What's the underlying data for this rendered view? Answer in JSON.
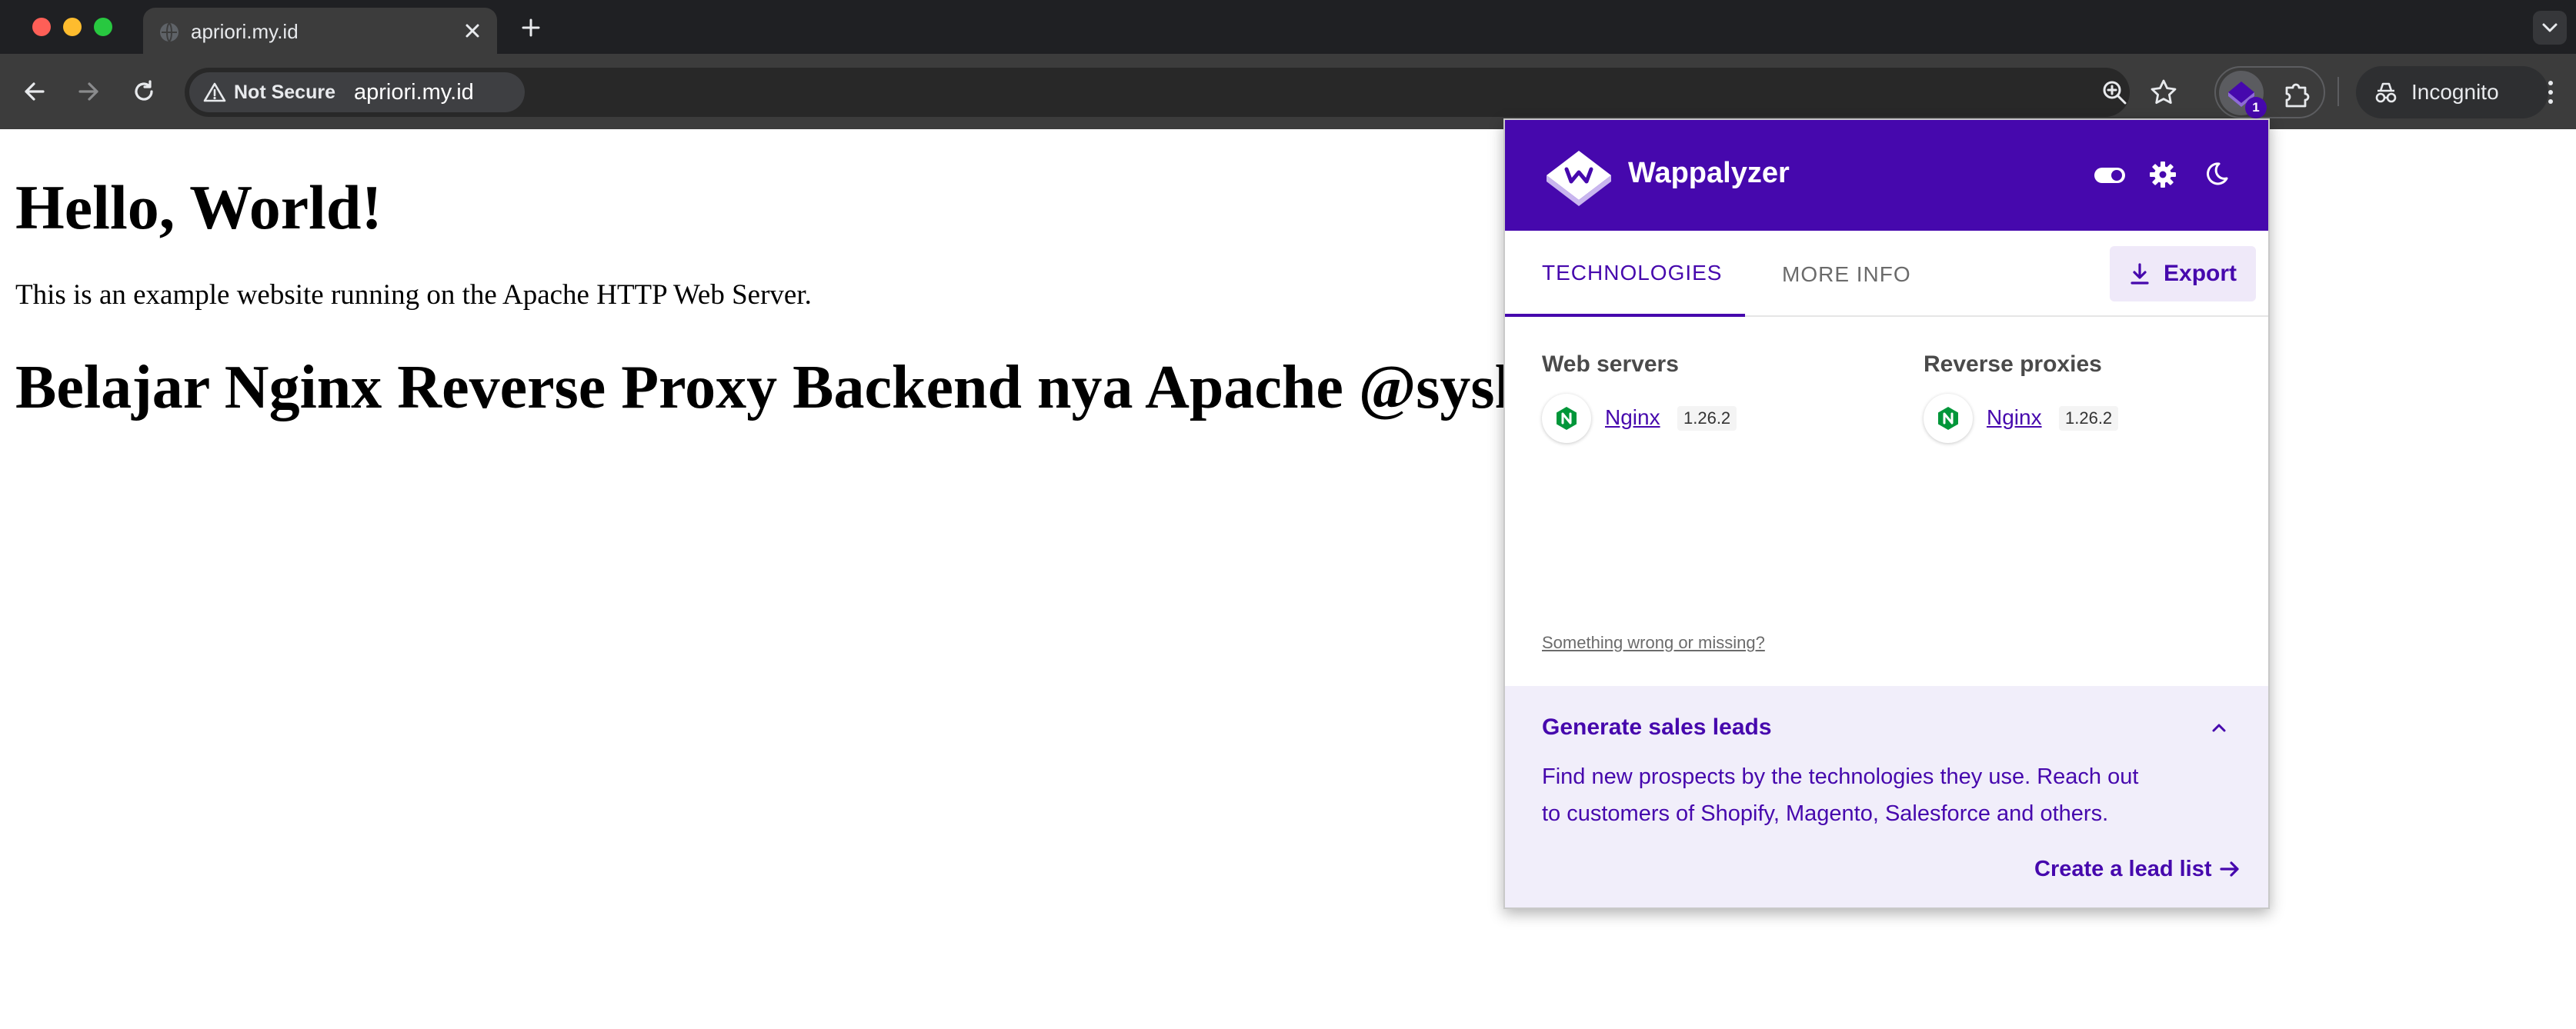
{
  "browser": {
    "tab": {
      "title": "apriori.my.id"
    },
    "address_bar": {
      "security_label": "Not Secure",
      "url": "apriori.my.id"
    },
    "profile_label": "Incognito",
    "extension_badge": "1",
    "icons": [
      "back-icon",
      "forward-icon",
      "reload-icon",
      "warning-icon",
      "zoom-icon",
      "star-icon",
      "puzzle-icon",
      "incognito-icon",
      "kebab-menu-icon"
    ]
  },
  "page": {
    "heading": "Hello, World!",
    "paragraph": "This is an example website running on the Apache HTTP Web Server.",
    "subheading": "Belajar Nginx Reverse Proxy Backend nya Apache @syshabit"
  },
  "wappalyzer": {
    "brand": "Wappalyzer",
    "tabs": {
      "technologies": "TECHNOLOGIES",
      "more_info": "MORE INFO"
    },
    "export_label": "Export",
    "categories": [
      {
        "title": "Web servers",
        "tech": {
          "name": "Nginx",
          "version": "1.26.2"
        }
      },
      {
        "title": "Reverse proxies",
        "tech": {
          "name": "Nginx",
          "version": "1.26.2"
        }
      }
    ],
    "missing_link": "Something wrong or missing?",
    "leads": {
      "title": "Generate sales leads",
      "body": "Find new prospects by the technologies they use. Reach out to customers of Shopify, Magento, Salesforce and others.",
      "cta": "Create a lead list"
    },
    "colors": {
      "brand": "#4608ad",
      "nginx": "#009639",
      "leads_bg": "#f1eefa"
    }
  }
}
